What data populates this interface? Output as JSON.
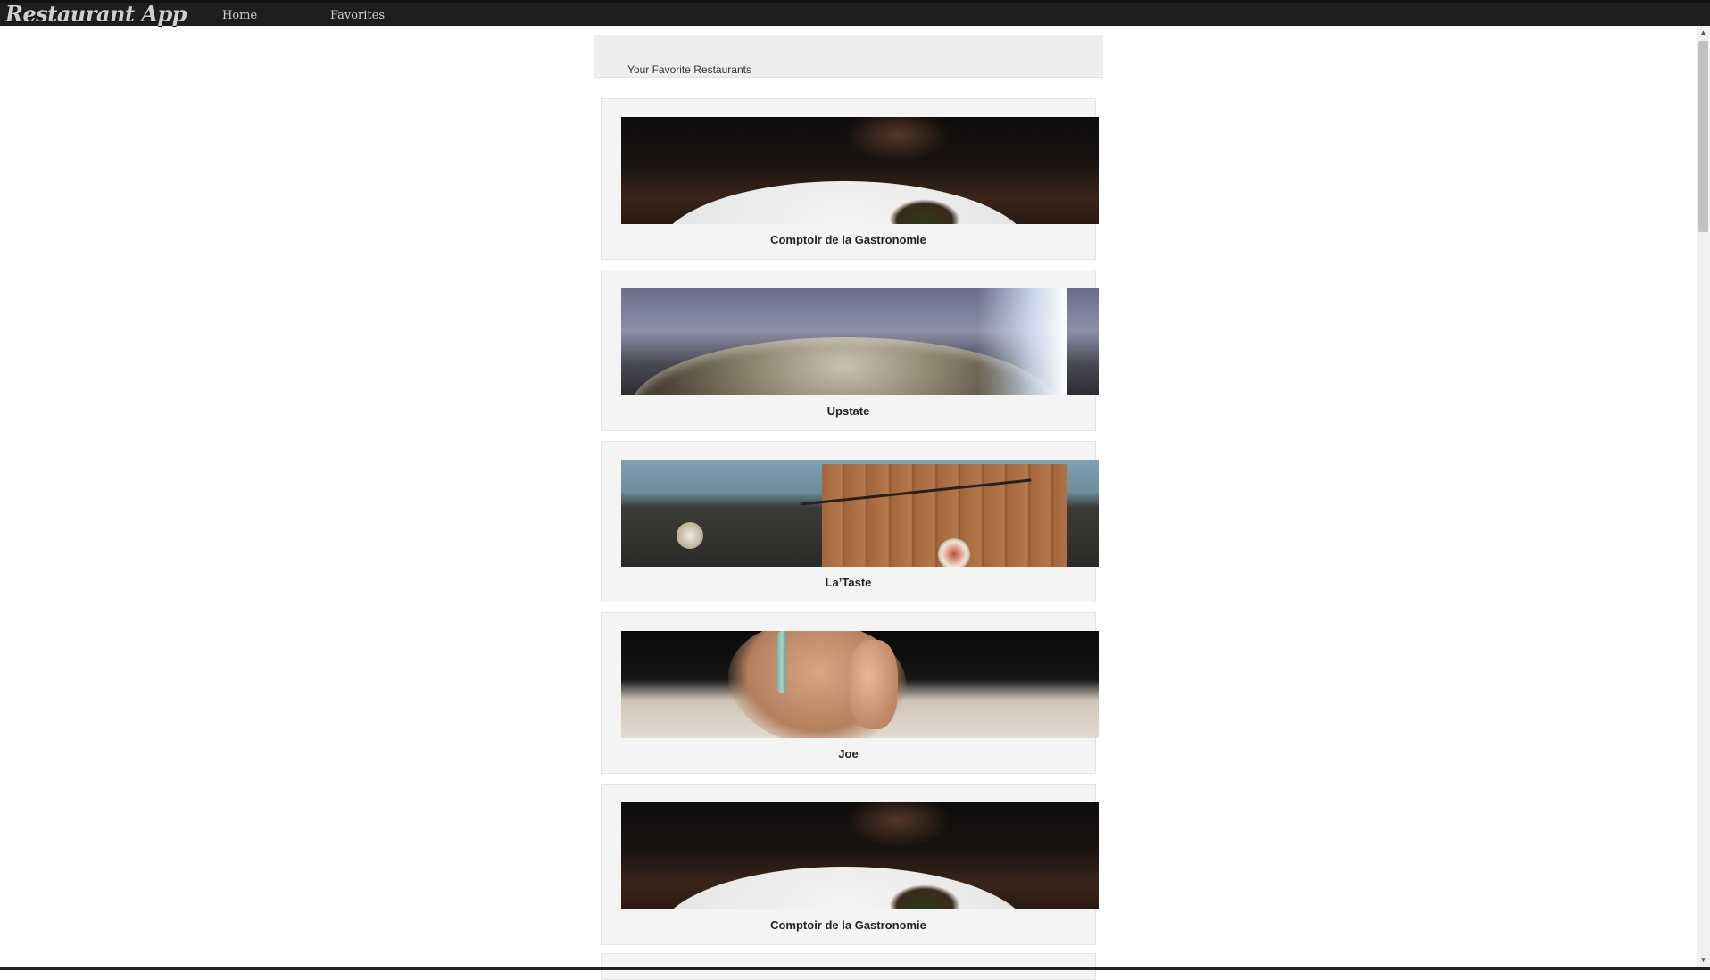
{
  "app": {
    "brand": "Restaurant App",
    "nav": [
      {
        "label": "Home"
      },
      {
        "label": "Favorites"
      }
    ]
  },
  "header": {
    "title": "Your Favorite Restaurants"
  },
  "restaurants": [
    {
      "name": "Comptoir de la Gastronomie",
      "photo": "plate-food-photo"
    },
    {
      "name": "Upstate",
      "photo": "steel-bowl-photo"
    },
    {
      "name": "La’Taste",
      "photo": "restaurant-interior-photo"
    },
    {
      "name": "Joe",
      "photo": "hand-photo"
    },
    {
      "name": "Comptoir de la Gastronomie",
      "photo": "plate-food-photo"
    }
  ],
  "scrollbar": {
    "up_icon": "▲",
    "down_icon": "▼"
  }
}
